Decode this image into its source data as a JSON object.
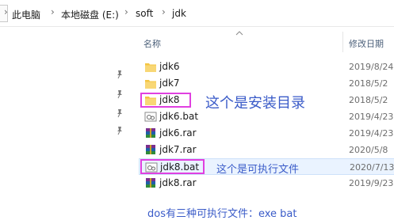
{
  "breadcrumb": {
    "items": [
      "此电脑",
      "本地磁盘 (E:)",
      "soft",
      "jdk"
    ],
    "separator": "›"
  },
  "columns": {
    "name": "名称",
    "date": "修改日期"
  },
  "files": [
    {
      "name": "jdk6",
      "type": "folder",
      "date": "2019/8/24"
    },
    {
      "name": "jdk7",
      "type": "folder",
      "date": "2018/5/2"
    },
    {
      "name": "jdk8",
      "type": "folder",
      "date": "2018/5/2"
    },
    {
      "name": "jdk6.bat",
      "type": "bat",
      "date": "2019/4/23"
    },
    {
      "name": "jdk6.rar",
      "type": "rar",
      "date": "2019/4/23"
    },
    {
      "name": "jdk7.rar",
      "type": "rar",
      "date": "2020/5/8"
    },
    {
      "name": "jdk8.bat",
      "type": "bat",
      "date": "2020/7/13"
    },
    {
      "name": "jdk8.rar",
      "type": "rar",
      "date": "2019/9/23"
    }
  ],
  "annotations": {
    "folder_note": "这个是安装目录",
    "bat_note": "这个是可执行文件",
    "footer_note": "dos有三种可执行文件：exe   bat"
  },
  "colors": {
    "highlight_border": "#e040e0",
    "annotation_text": "#3a5bc8",
    "selected_row": "#eaf3ff",
    "folder": "#f4c542"
  }
}
